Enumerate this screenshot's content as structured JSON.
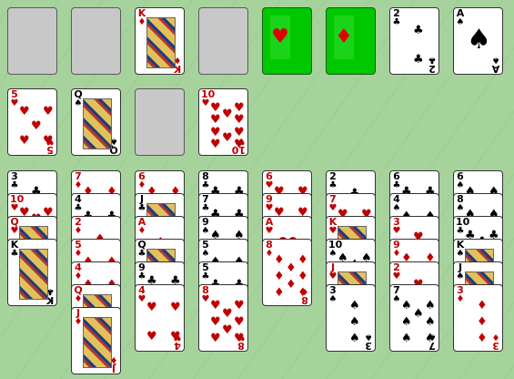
{
  "free_cells": [
    {
      "state": "empty"
    },
    {
      "state": "empty"
    },
    {
      "state": "card",
      "rank": "K",
      "suit": "♦",
      "color": "red",
      "face": true
    },
    {
      "state": "empty"
    }
  ],
  "foundations": [
    {
      "state": "empty_suit",
      "suit": "♥"
    },
    {
      "state": "empty_suit",
      "suit": "♦"
    },
    {
      "state": "card",
      "rank": "2",
      "suit": "♣",
      "color": "black"
    },
    {
      "state": "card",
      "rank": "A",
      "suit": "♠",
      "color": "black",
      "ace": true
    }
  ],
  "reserve_row": [
    {
      "state": "card",
      "rank": "5",
      "suit": "♥",
      "color": "red"
    },
    {
      "state": "card",
      "rank": "Q",
      "suit": "♠",
      "color": "black",
      "face": true
    },
    {
      "state": "empty"
    },
    {
      "state": "card",
      "rank": "10",
      "suit": "♥",
      "color": "red"
    }
  ],
  "tableau": [
    [
      {
        "rank": "3",
        "suit": "♣"
      },
      {
        "rank": "10",
        "suit": "♥"
      },
      {
        "rank": "Q",
        "suit": "♥",
        "face": true
      },
      {
        "rank": "K",
        "suit": "♣",
        "face": true
      }
    ],
    [
      {
        "rank": "7",
        "suit": "♦"
      },
      {
        "rank": "4",
        "suit": "♣"
      },
      {
        "rank": "2",
        "suit": "♦"
      },
      {
        "rank": "5",
        "suit": "♦"
      },
      {
        "rank": "4",
        "suit": "♦"
      },
      {
        "rank": "Q",
        "suit": "♦",
        "face": true
      },
      {
        "rank": "J",
        "suit": "♦",
        "face": true
      }
    ],
    [
      {
        "rank": "6",
        "suit": "♦"
      },
      {
        "rank": "J",
        "suit": "♣",
        "face": true
      },
      {
        "rank": "A",
        "suit": "♦"
      },
      {
        "rank": "Q",
        "suit": "♣",
        "face": true
      },
      {
        "rank": "9",
        "suit": "♣"
      },
      {
        "rank": "4",
        "suit": "♥"
      }
    ],
    [
      {
        "rank": "8",
        "suit": "♣"
      },
      {
        "rank": "7",
        "suit": "♣"
      },
      {
        "rank": "9",
        "suit": "♠"
      },
      {
        "rank": "5",
        "suit": "♠"
      },
      {
        "rank": "5",
        "suit": "♣"
      },
      {
        "rank": "8",
        "suit": "♥"
      }
    ],
    [
      {
        "rank": "6",
        "suit": "♥"
      },
      {
        "rank": "9",
        "suit": "♥"
      },
      {
        "rank": "A",
        "suit": "♥"
      },
      {
        "rank": "8",
        "suit": "♦"
      }
    ],
    [
      {
        "rank": "2",
        "suit": "♣"
      },
      {
        "rank": "7",
        "suit": "♥"
      },
      {
        "rank": "K",
        "suit": "♥",
        "face": true
      },
      {
        "rank": "10",
        "suit": "♠"
      },
      {
        "rank": "J",
        "suit": "♥",
        "face": true
      },
      {
        "rank": "3",
        "suit": "♠"
      }
    ],
    [
      {
        "rank": "6",
        "suit": "♣"
      },
      {
        "rank": "4",
        "suit": "♠"
      },
      {
        "rank": "3",
        "suit": "♥"
      },
      {
        "rank": "9",
        "suit": "♦"
      },
      {
        "rank": "2",
        "suit": "♥"
      },
      {
        "rank": "7",
        "suit": "♠"
      }
    ],
    [
      {
        "rank": "6",
        "suit": "♠"
      },
      {
        "rank": "8",
        "suit": "♠"
      },
      {
        "rank": "10",
        "suit": "♣"
      },
      {
        "rank": "K",
        "suit": "♠",
        "face": true
      },
      {
        "rank": "J",
        "suit": "♠",
        "face": true
      },
      {
        "rank": "3",
        "suit": "♦"
      }
    ]
  ]
}
